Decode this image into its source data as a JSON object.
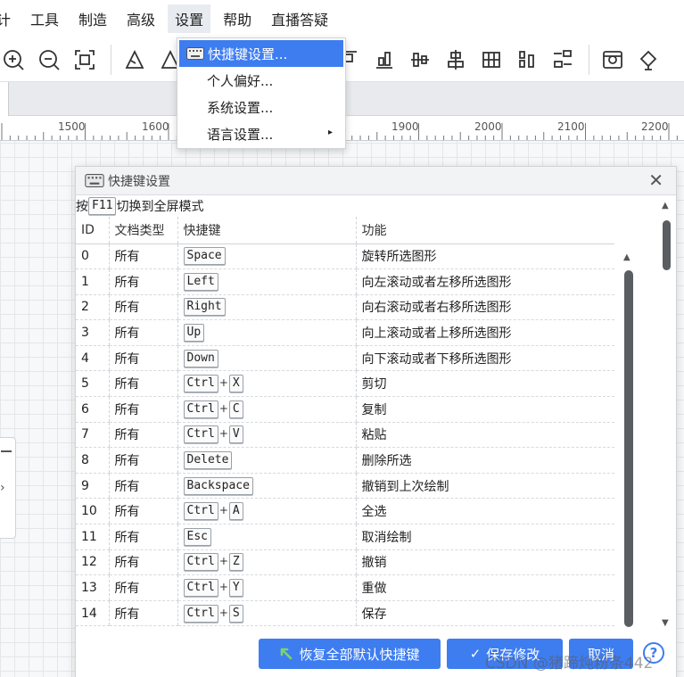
{
  "menubar": {
    "items": [
      {
        "label": "计"
      },
      {
        "label": "工具"
      },
      {
        "label": "制造"
      },
      {
        "label": "高级"
      },
      {
        "label": "设置"
      },
      {
        "label": "帮助"
      },
      {
        "label": "直播答疑"
      }
    ],
    "active_index": 4
  },
  "toolbar": {
    "icons": [
      "zoom-in-icon",
      "zoom-out-icon",
      "fit-screen-icon",
      "transform-icon",
      "transform-alt-icon",
      "align-top-icon",
      "align-bottom-icon",
      "align-vcenter-icon",
      "align-hcenter-icon",
      "grid-icon",
      "distribute-icon",
      "distribute-alt-icon",
      "image-icon",
      "paint-icon"
    ]
  },
  "ruler": {
    "labels": [
      "1500",
      "1600",
      "1900",
      "2000",
      "2100",
      "2200"
    ]
  },
  "settings_menu": {
    "items": [
      {
        "label": "快捷键设置..."
      },
      {
        "label": "个人偏好..."
      },
      {
        "label": "系统设置..."
      },
      {
        "label": "语言设置..."
      }
    ],
    "selected_index": 0,
    "submenu_arrow": "▸"
  },
  "dialog": {
    "title": "快捷键设置",
    "close_label": "✕",
    "hint": {
      "before": "按",
      "key": "F11",
      "after": "切换到全屏模式"
    },
    "columns": {
      "id": "ID",
      "doc_type": "文档类型",
      "shortcut": "快捷键",
      "function": "功能"
    },
    "plus": "+",
    "rows": [
      {
        "id": "0",
        "doc_type": "所有",
        "keys": [
          "Space"
        ],
        "function": "旋转所选图形"
      },
      {
        "id": "1",
        "doc_type": "所有",
        "keys": [
          "Left"
        ],
        "function": "向左滚动或者左移所选图形"
      },
      {
        "id": "2",
        "doc_type": "所有",
        "keys": [
          "Right"
        ],
        "function": "向右滚动或者右移所选图形"
      },
      {
        "id": "3",
        "doc_type": "所有",
        "keys": [
          "Up"
        ],
        "function": "向上滚动或者上移所选图形"
      },
      {
        "id": "4",
        "doc_type": "所有",
        "keys": [
          "Down"
        ],
        "function": "向下滚动或者下移所选图形"
      },
      {
        "id": "5",
        "doc_type": "所有",
        "keys": [
          "Ctrl",
          "X"
        ],
        "function": "剪切"
      },
      {
        "id": "6",
        "doc_type": "所有",
        "keys": [
          "Ctrl",
          "C"
        ],
        "function": "复制"
      },
      {
        "id": "7",
        "doc_type": "所有",
        "keys": [
          "Ctrl",
          "V"
        ],
        "function": "粘贴"
      },
      {
        "id": "8",
        "doc_type": "所有",
        "keys": [
          "Delete"
        ],
        "function": "删除所选"
      },
      {
        "id": "9",
        "doc_type": "所有",
        "keys": [
          "Backspace"
        ],
        "function": "撤销到上次绘制"
      },
      {
        "id": "10",
        "doc_type": "所有",
        "keys": [
          "Ctrl",
          "A"
        ],
        "function": "全选"
      },
      {
        "id": "11",
        "doc_type": "所有",
        "keys": [
          "Esc"
        ],
        "function": "取消绘制"
      },
      {
        "id": "12",
        "doc_type": "所有",
        "keys": [
          "Ctrl",
          "Z"
        ],
        "function": "撤销"
      },
      {
        "id": "13",
        "doc_type": "所有",
        "keys": [
          "Ctrl",
          "Y"
        ],
        "function": "重做"
      },
      {
        "id": "14",
        "doc_type": "所有",
        "keys": [
          "Ctrl",
          "S"
        ],
        "function": "保存"
      }
    ],
    "buttons": {
      "reset": "恢复全部默认快捷键",
      "save": "保存修改",
      "cancel": "取消",
      "help": "?"
    }
  },
  "watermark": "CSDN @猪蹄炖粉条442",
  "colors": {
    "accent": "#3e7df0"
  }
}
